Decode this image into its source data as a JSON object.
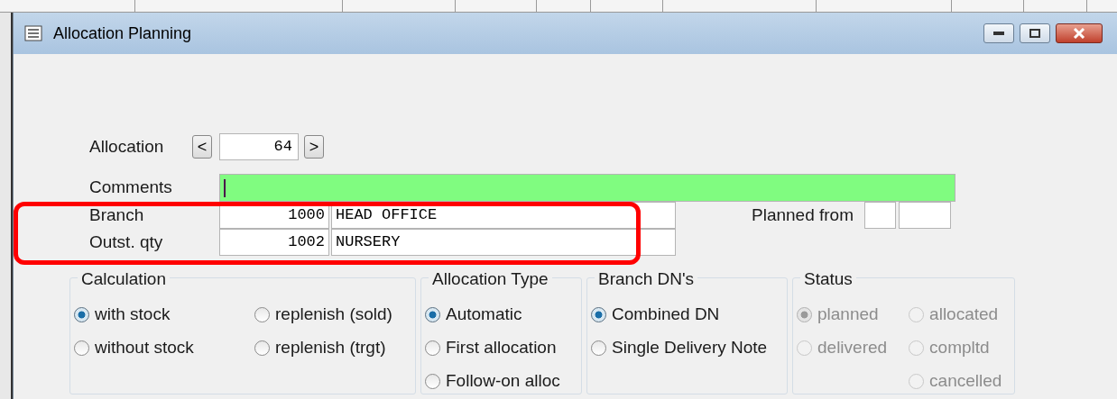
{
  "window": {
    "title": "Allocation Planning"
  },
  "allocation": {
    "label": "Allocation",
    "prev": "<",
    "value": "64",
    "next": ">"
  },
  "comments": {
    "label": "Comments"
  },
  "branch": {
    "label": "Branch",
    "code": "1000",
    "name": "HEAD OFFICE"
  },
  "outstanding": {
    "label": "Outst. qty",
    "code": "1002",
    "name": "NURSERY"
  },
  "planned_from": {
    "label": "Planned from"
  },
  "groups": [
    {
      "title": "Calculation",
      "disabled": false,
      "columns": [
        [
          {
            "label": "with stock",
            "selected": true
          },
          {
            "label": "without stock",
            "selected": false
          }
        ],
        [
          {
            "label": "replenish (sold)",
            "selected": false
          },
          {
            "label": "replenish (trgt)",
            "selected": false
          }
        ]
      ]
    },
    {
      "title": "Allocation Type",
      "disabled": false,
      "columns": [
        [
          {
            "label": "Automatic",
            "selected": true
          },
          {
            "label": "First allocation",
            "selected": false
          },
          {
            "label": "Follow-on alloc",
            "selected": false
          }
        ]
      ]
    },
    {
      "title": "Branch DN's",
      "disabled": false,
      "columns": [
        [
          {
            "label": "Combined DN",
            "selected": true
          },
          {
            "label": "Single Delivery Note",
            "selected": false
          }
        ]
      ]
    },
    {
      "title": "Status",
      "disabled": true,
      "columns": [
        [
          {
            "label": "planned",
            "selected": true
          },
          {
            "label": "delivered",
            "selected": false
          }
        ],
        [
          {
            "label": "allocated",
            "selected": false
          },
          {
            "label": "compltd",
            "selected": false
          },
          {
            "label": "cancelled",
            "selected": false
          }
        ]
      ]
    }
  ]
}
